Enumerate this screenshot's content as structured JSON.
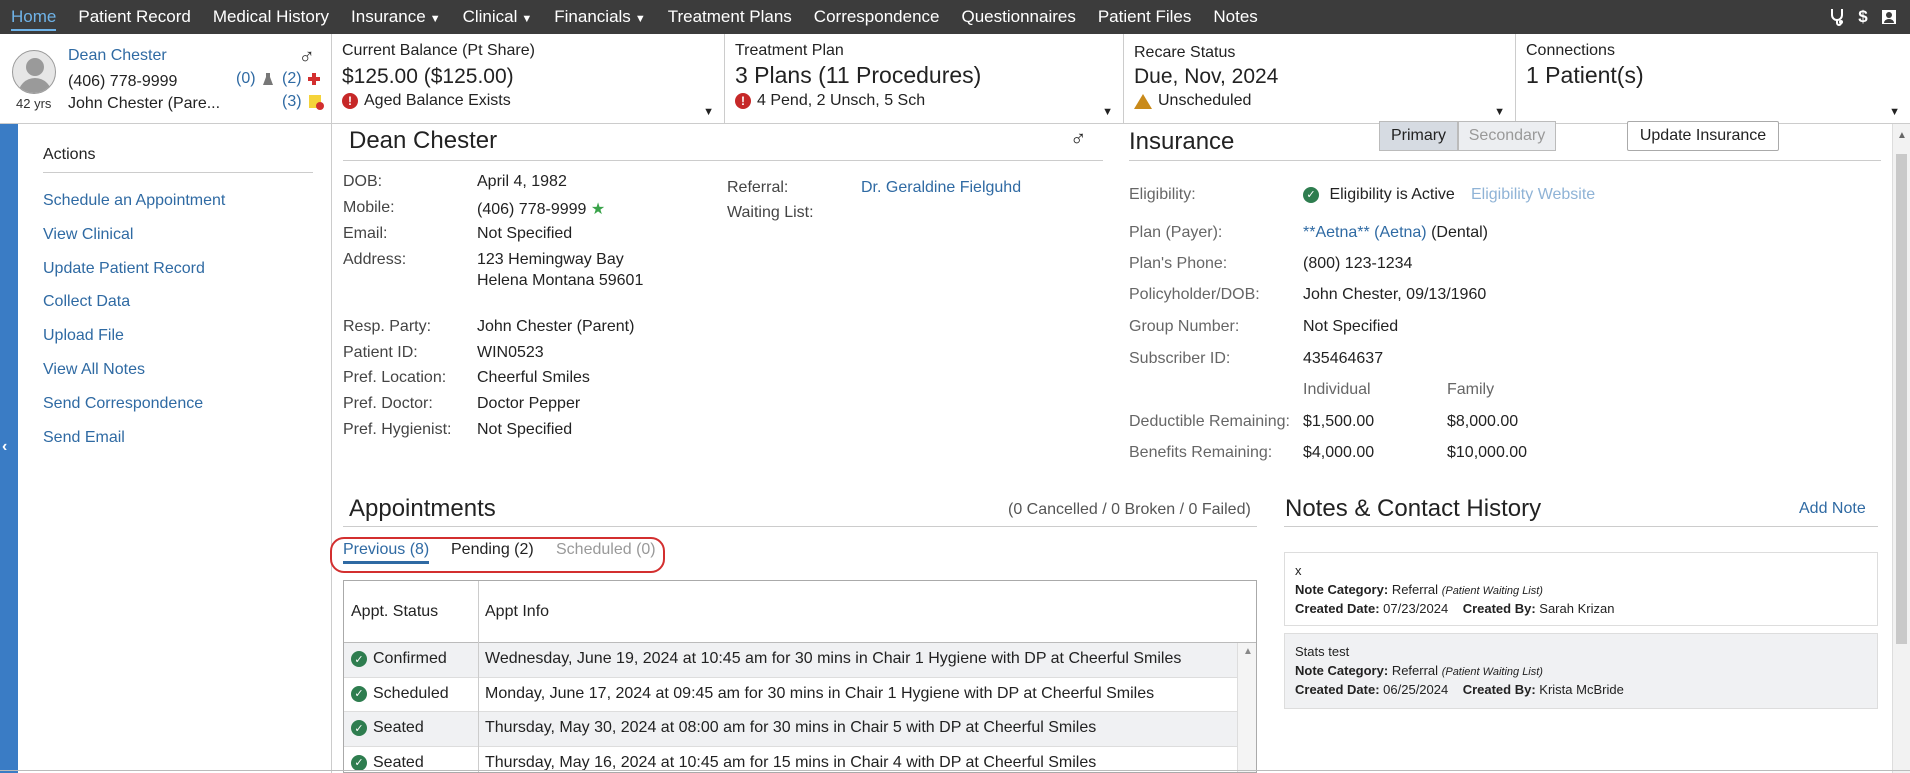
{
  "nav": {
    "items": [
      {
        "label": "Home",
        "active": true,
        "dropdown": false
      },
      {
        "label": "Patient Record",
        "dropdown": false
      },
      {
        "label": "Medical History",
        "dropdown": false
      },
      {
        "label": "Insurance",
        "dropdown": true
      },
      {
        "label": "Clinical",
        "dropdown": true
      },
      {
        "label": "Financials",
        "dropdown": true
      },
      {
        "label": "Treatment Plans",
        "dropdown": false
      },
      {
        "label": "Correspondence",
        "dropdown": false
      },
      {
        "label": "Questionnaires",
        "dropdown": false
      },
      {
        "label": "Patient Files",
        "dropdown": false
      },
      {
        "label": "Notes",
        "dropdown": false
      }
    ],
    "right_icons": [
      "stethoscope-icon",
      "dollar-icon",
      "contact-card-icon"
    ],
    "dollar_glyph": "$"
  },
  "patient_card": {
    "name": "Dean Chester",
    "phone": "(406) 778-9999",
    "responsible": "John Chester (Pare...",
    "age": "42 yrs",
    "count_lab": "(0)",
    "count_medical": "(2)",
    "count_alerts": "(3)"
  },
  "balance": {
    "title": "Current Balance (Pt Share)",
    "amount": "$125.00 ($125.00)",
    "alert": "Aged Balance Exists"
  },
  "treatment_plan": {
    "title": "Treatment Plan",
    "summary": "3 Plans (11 Procedures)",
    "detail": "4 Pend, 2 Unsch, 5 Sch"
  },
  "recare": {
    "title": "Recare Status",
    "due": "Due, Nov, 2024",
    "status": "Unscheduled"
  },
  "connections": {
    "title": "Connections",
    "value": "1 Patient(s)"
  },
  "actions": {
    "title": "Actions",
    "items": [
      "Schedule an Appointment",
      "View Clinical",
      "Update Patient Record",
      "Collect Data",
      "Upload File",
      "View All Notes",
      "Send Correspondence",
      "Send Email"
    ]
  },
  "demographics": {
    "name": "Dean Chester",
    "dob_label": "DOB:",
    "dob": "April 4, 1982",
    "mobile_label": "Mobile:",
    "mobile": "(406) 778-9999",
    "email_label": "Email:",
    "email": "Not Specified",
    "address_label": "Address:",
    "address_line1": "123 Hemingway Bay",
    "address_line2": "Helena Montana 59601",
    "resp_label": "Resp. Party:",
    "resp": "John Chester (Parent)",
    "pid_label": "Patient ID:",
    "pid": "WIN0523",
    "location_label": "Pref. Location:",
    "location": "Cheerful Smiles",
    "doctor_label": "Pref. Doctor:",
    "doctor": "Doctor Pepper",
    "hygienist_label": "Pref. Hygienist:",
    "hygienist": "Not Specified",
    "referral_label": "Referral:",
    "referral": "Dr. Geraldine Fielguhd",
    "waiting_label": "Waiting List:"
  },
  "insurance": {
    "title": "Insurance",
    "tab_primary": "Primary",
    "tab_secondary": "Secondary",
    "update_button": "Update Insurance",
    "eligibility_label": "Eligibility:",
    "eligibility": "Eligibility is Active",
    "eligibility_link": "Eligibility Website",
    "plan_label": "Plan (Payer):",
    "plan_link": "**Aetna** (Aetna)",
    "plan_type": "(Dental)",
    "phone_label": "Plan's Phone:",
    "phone": "(800) 123-1234",
    "policyholder_label": "Policyholder/DOB:",
    "policyholder": "John Chester, 09/13/1960",
    "group_label": "Group Number:",
    "group": "Not Specified",
    "subscriber_label": "Subscriber ID:",
    "subscriber": "435464637",
    "col_individual": "Individual",
    "col_family": "Family",
    "deductible_label": "Deductible Remaining:",
    "deductible_individual": "$1,500.00",
    "deductible_family": "$8,000.00",
    "benefits_label": "Benefits Remaining:",
    "benefits_individual": "$4,000.00",
    "benefits_family": "$10,000.00"
  },
  "appointments": {
    "title": "Appointments",
    "summary": "(0 Cancelled / 0 Broken / 0 Failed)",
    "tabs": [
      "Previous (8)",
      "Pending (2)",
      "Scheduled (0)"
    ],
    "col_status": "Appt. Status",
    "col_info": "Appt Info",
    "rows": [
      {
        "status": "Confirmed",
        "info": "Wednesday, June 19, 2024 at 10:45 am for 30 mins in Chair 1 Hygiene with DP at Cheerful Smiles"
      },
      {
        "status": "Scheduled",
        "info": "Monday, June 17, 2024 at 09:45 am for 30 mins in Chair 1 Hygiene with DP at Cheerful Smiles"
      },
      {
        "status": "Seated",
        "info": "Thursday, May 30, 2024 at 08:00 am for 30 mins in Chair 5 with DP at Cheerful Smiles"
      },
      {
        "status": "Seated",
        "info": "Thursday, May 16, 2024 at 10:45 am for 15 mins in Chair 4 with DP at Cheerful Smiles"
      }
    ]
  },
  "notes": {
    "title": "Notes & Contact History",
    "add_link": "Add Note",
    "category_label": "Note Category:",
    "created_label": "Created Date:",
    "by_label": "Created By:",
    "items": [
      {
        "text": "x",
        "category": "Referral",
        "sub": "(Patient Waiting List)",
        "date": "07/23/2024",
        "by": "Sarah Krizan"
      },
      {
        "text": "Stats test",
        "category": "Referral",
        "sub": "(Patient Waiting List)",
        "date": "06/25/2024",
        "by": "Krista McBride"
      }
    ]
  },
  "colors": {
    "accent": "#2f6aa3",
    "nav_bg": "#3c3c3c",
    "sidebar_strip": "#3a7cc5",
    "highlight_box": "#d32f2f"
  }
}
